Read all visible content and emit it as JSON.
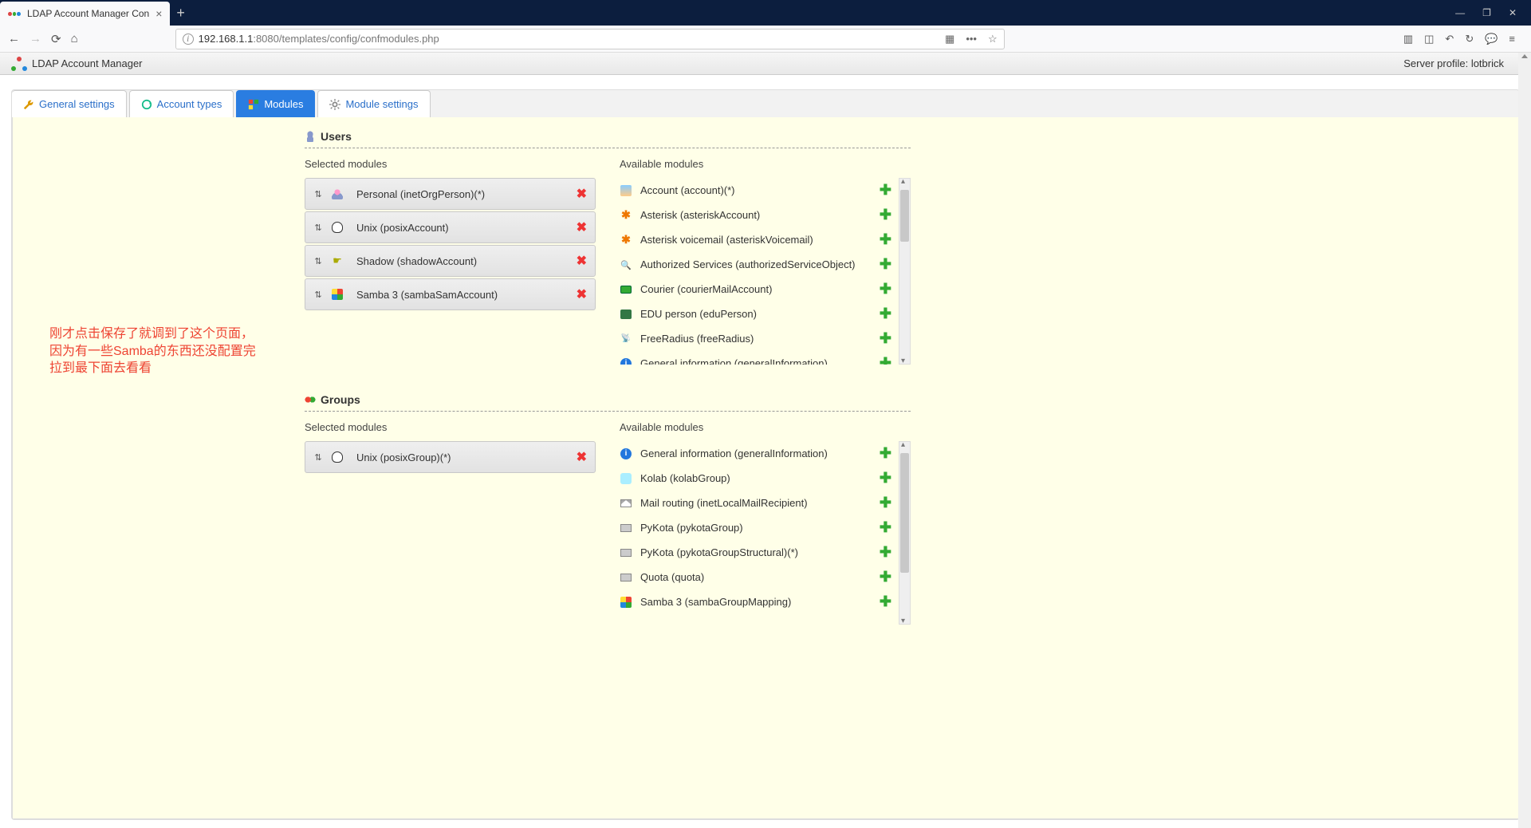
{
  "browser": {
    "tab_title": "LDAP Account Manager Con",
    "url_host": "192.168.1.1",
    "url_rest": ":8080/templates/config/confmodules.php"
  },
  "header": {
    "app_title": "LDAP Account Manager",
    "server_profile_label": "Server profile:",
    "server_profile_value": "lotbrick"
  },
  "tabs": {
    "general": "General settings",
    "account_types": "Account types",
    "modules": "Modules",
    "module_settings": "Module settings"
  },
  "annotation": {
    "line1": "刚才点击保存了就调到了这个页面，",
    "line2": "因为有一些Samba的东西还没配置完",
    "line3": "拉到最下面去看看"
  },
  "users": {
    "title": "Users",
    "selected_label": "Selected modules",
    "available_label": "Available modules",
    "selected": [
      {
        "label": "Personal (inetOrgPerson)(*)",
        "icon": "person-icon"
      },
      {
        "label": "Unix (posixAccount)",
        "icon": "tux-icon"
      },
      {
        "label": "Shadow (shadowAccount)",
        "icon": "shadow-icon"
      },
      {
        "label": "Samba 3 (sambaSamAccount)",
        "icon": "windows-icon"
      }
    ],
    "available": [
      {
        "label": "Account (account)(*)",
        "icon": "account-icon"
      },
      {
        "label": "Asterisk (asteriskAccount)",
        "icon": "asterisk-icon"
      },
      {
        "label": "Asterisk voicemail (asteriskVoicemail)",
        "icon": "asterisk-icon"
      },
      {
        "label": "Authorized Services (authorizedServiceObject)",
        "icon": "magnify-icon"
      },
      {
        "label": "Courier (courierMailAccount)",
        "icon": "courier-icon"
      },
      {
        "label": "EDU person (eduPerson)",
        "icon": "edu-icon"
      },
      {
        "label": "FreeRadius (freeRadius)",
        "icon": "radius-icon"
      },
      {
        "label": "General information (generalInformation)",
        "icon": "info-icon"
      }
    ]
  },
  "groups": {
    "title": "Groups",
    "selected_label": "Selected modules",
    "available_label": "Available modules",
    "selected": [
      {
        "label": "Unix (posixGroup)(*)",
        "icon": "tux-icon"
      }
    ],
    "available": [
      {
        "label": "General information (generalInformation)",
        "icon": "info-icon"
      },
      {
        "label": "Kolab (kolabGroup)",
        "icon": "kolab-icon"
      },
      {
        "label": "Mail routing (inetLocalMailRecipient)",
        "icon": "mail-icon"
      },
      {
        "label": "PyKota (pykotaGroup)",
        "icon": "pykota-icon"
      },
      {
        "label": "PyKota (pykotaGroupStructural)(*)",
        "icon": "pykota-icon"
      },
      {
        "label": "Quota (quota)",
        "icon": "pykota-icon"
      },
      {
        "label": "Samba 3 (sambaGroupMapping)",
        "icon": "windows-icon"
      }
    ]
  }
}
